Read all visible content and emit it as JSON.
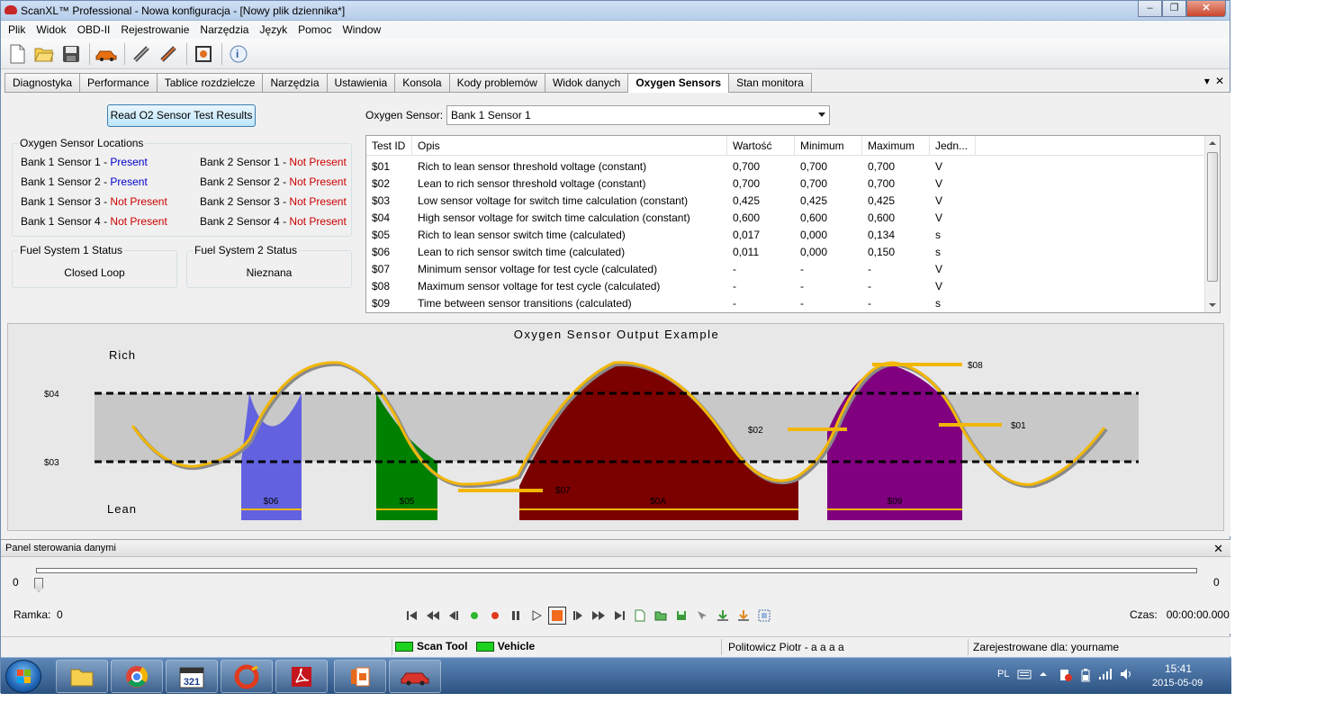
{
  "window": {
    "title": "ScanXL™ Professional - Nowa konfiguracja - [Nowy plik dziennika*]",
    "minimize": "‒",
    "maximize": "❐",
    "close": "✕"
  },
  "menu": [
    "Plik",
    "Widok",
    "OBD-II",
    "Rejestrowanie",
    "Narzędzia",
    "Język",
    "Pomoc",
    "Window"
  ],
  "toolbar_icons": [
    "new-file-icon",
    "open-folder-icon",
    "save-icon",
    "car-icon",
    "connect-icon",
    "disconnect-icon",
    "settings-frame-icon",
    "help-icon"
  ],
  "tabs": [
    {
      "label": "Diagnostyka",
      "active": false
    },
    {
      "label": "Performance",
      "active": false
    },
    {
      "label": "Tablice rozdzielcze",
      "active": false
    },
    {
      "label": "Narzędzia",
      "active": false
    },
    {
      "label": "Ustawienia",
      "active": false
    },
    {
      "label": "Konsola",
      "active": false
    },
    {
      "label": "Kody problemów",
      "active": false
    },
    {
      "label": "Widok danych",
      "active": false
    },
    {
      "label": "Oxygen Sensors",
      "active": true
    },
    {
      "label": "Stan monitora",
      "active": false
    }
  ],
  "tab_controls": {
    "dropdown": "▾",
    "close": "✕"
  },
  "oxygen": {
    "read_button": "Read O2 Sensor Test Results",
    "locations_title": "Oxygen Sensor Locations",
    "locations": [
      {
        "name": "Bank 1 Sensor 1",
        "status": "Present",
        "present": true
      },
      {
        "name": "Bank 2 Sensor 1",
        "status": "Not Present",
        "present": false
      },
      {
        "name": "Bank 1 Sensor 2",
        "status": "Present",
        "present": true
      },
      {
        "name": "Bank 2 Sensor 2",
        "status": "Not Present",
        "present": false
      },
      {
        "name": "Bank 1 Sensor 3",
        "status": "Not Present",
        "present": false
      },
      {
        "name": "Bank 2 Sensor 3",
        "status": "Not Present",
        "present": false
      },
      {
        "name": "Bank 1 Sensor 4",
        "status": "Not Present",
        "present": false
      },
      {
        "name": "Bank 2 Sensor 4",
        "status": "Not Present",
        "present": false
      }
    ],
    "separator": "-",
    "fuel1_title": "Fuel System 1 Status",
    "fuel1_value": "Closed Loop",
    "fuel2_title": "Fuel System 2 Status",
    "fuel2_value": "Nieznana",
    "sensor_label": "Oxygen Sensor:",
    "sensor_value": "Bank 1 Sensor 1"
  },
  "table": {
    "headers": [
      "Test ID",
      "Opis",
      "Wartość",
      "Minimum",
      "Maximum",
      "Jedn..."
    ],
    "rows": [
      [
        "$01",
        "Rich to lean sensor threshold voltage (constant)",
        "0,700",
        "0,700",
        "0,700",
        "V"
      ],
      [
        "$02",
        "Lean to rich sensor threshold voltage (constant)",
        "0,700",
        "0,700",
        "0,700",
        "V"
      ],
      [
        "$03",
        "Low sensor voltage for switch time calculation (constant)",
        "0,425",
        "0,425",
        "0,425",
        "V"
      ],
      [
        "$04",
        "High sensor voltage for switch time calculation (constant)",
        "0,600",
        "0,600",
        "0,600",
        "V"
      ],
      [
        "$05",
        "Rich to lean sensor switch time (calculated)",
        "0,017",
        "0,000",
        "0,134",
        "s"
      ],
      [
        "$06",
        "Lean to rich sensor switch time (calculated)",
        "0,011",
        "0,000",
        "0,150",
        "s"
      ],
      [
        "$07",
        "Minimum sensor voltage for test cycle (calculated)",
        "-",
        "-",
        "-",
        "V"
      ],
      [
        "$08",
        "Maximum sensor voltage for test cycle (calculated)",
        "-",
        "-",
        "-",
        "V"
      ],
      [
        "$09",
        "Time between sensor transitions (calculated)",
        "-",
        "-",
        "-",
        "s"
      ]
    ]
  },
  "diagram": {
    "title": "Oxygen Sensor Output Example",
    "rich": "Rich",
    "lean": "Lean",
    "label_04": "$04",
    "label_03": "$03",
    "label_06": "$06",
    "label_05": "$05",
    "label_07": "$07",
    "label_0a": "$0A",
    "label_09": "$09",
    "label_02": "$02",
    "label_01": "$01",
    "label_08": "$08",
    "colors": {
      "band": "#c8c8c8",
      "s06": "#6262e0",
      "s05": "#008000",
      "s0a": "#7b0000",
      "s09": "#800080",
      "curve": "#f2b705",
      "line": "#f2b705"
    }
  },
  "control_panel": {
    "title": "Panel sterowania danymi",
    "close": "✕",
    "slider_min": "0",
    "slider_max": "0",
    "slider_position": 0,
    "frame_label": "Ramka:",
    "frame_value": "0",
    "time_label": "Czas:",
    "time_value": "00:00:00.000",
    "player_icons": [
      "first-icon",
      "rewind-icon",
      "step-back-icon",
      "play-green-icon",
      "record-icon",
      "pause-icon",
      "play-icon",
      "stop-icon",
      "step-forward-icon",
      "fast-forward-icon",
      "last-icon",
      "new-log-icon",
      "open-log-icon",
      "save-log-icon",
      "bookmark-icon",
      "import-icon",
      "export-icon",
      "frame-select-icon"
    ]
  },
  "status": {
    "scan_tool": "Scan Tool",
    "vehicle": "Vehicle",
    "user": "Politowicz Piotr - a a a a",
    "registered": "Zarejestrowane dla: yourname"
  },
  "taskbar": {
    "apps": [
      "explorer-icon",
      "chrome-icon",
      "calendar-321-icon",
      "ccleaner-icon",
      "acrobat-icon",
      "office-icon",
      "scanxl-icon"
    ],
    "calendar_text": "321",
    "language": "PL",
    "time": "15:41",
    "date": "2015-05-09"
  }
}
